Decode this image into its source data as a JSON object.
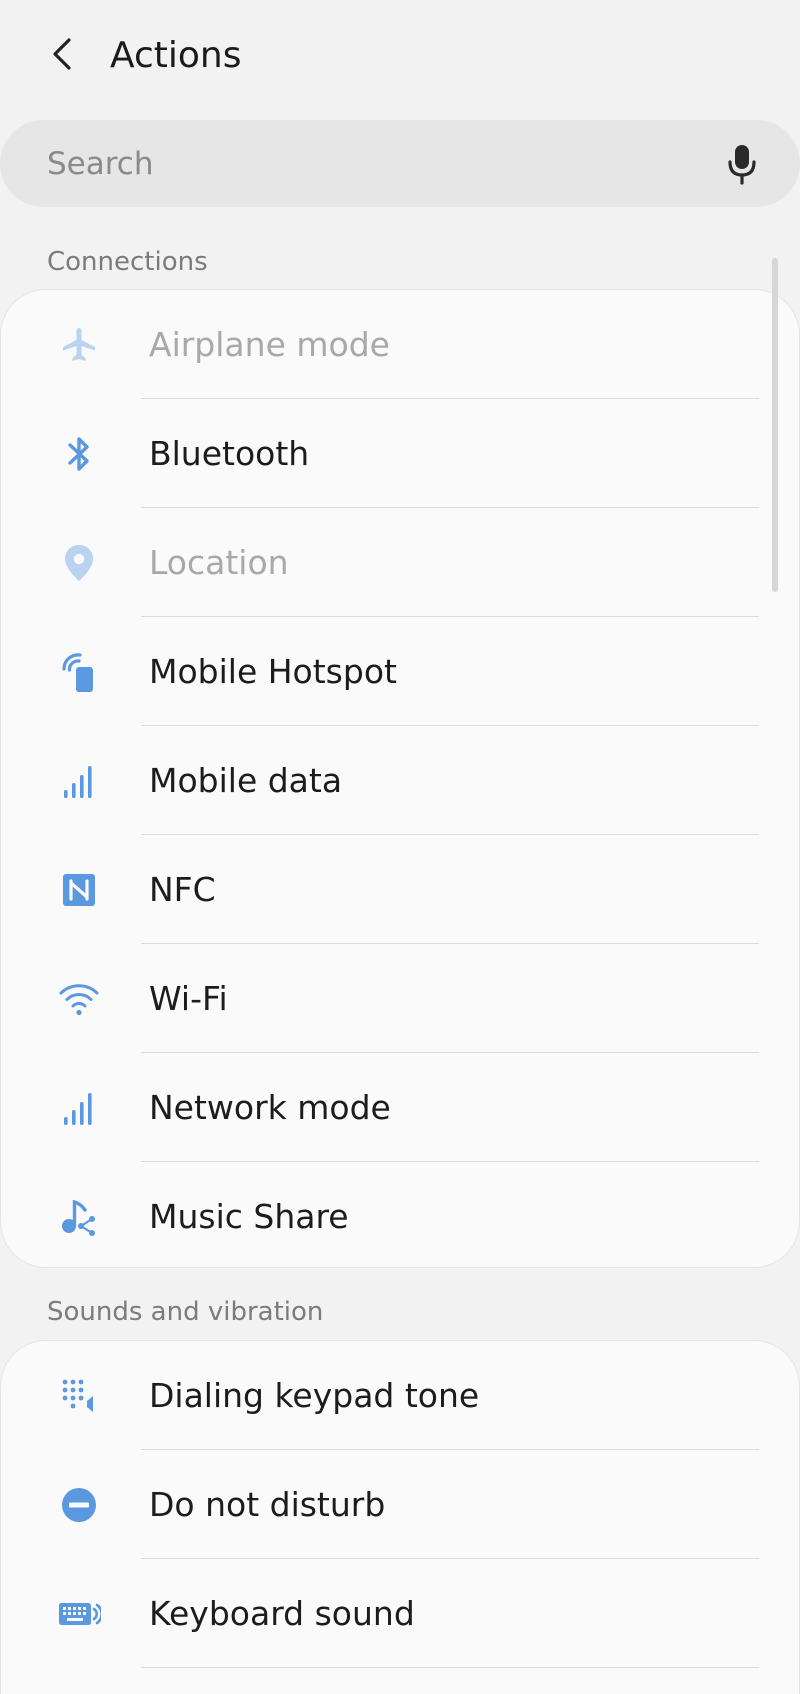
{
  "header": {
    "title": "Actions",
    "back_icon": "chevron-left-icon"
  },
  "search": {
    "placeholder": "Search",
    "value": "",
    "mic_icon": "microphone-icon"
  },
  "sections": [
    {
      "title": "Connections",
      "items": [
        {
          "label": "Airplane mode",
          "icon": "airplane-icon",
          "enabled": false
        },
        {
          "label": "Bluetooth",
          "icon": "bluetooth-icon",
          "enabled": true
        },
        {
          "label": "Location",
          "icon": "location-pin-icon",
          "enabled": false
        },
        {
          "label": "Mobile Hotspot",
          "icon": "hotspot-icon",
          "enabled": true
        },
        {
          "label": "Mobile data",
          "icon": "signal-bars-icon",
          "enabled": true
        },
        {
          "label": "NFC",
          "icon": "nfc-icon",
          "enabled": true
        },
        {
          "label": "Wi-Fi",
          "icon": "wifi-icon",
          "enabled": true
        },
        {
          "label": "Network mode",
          "icon": "signal-bars-icon",
          "enabled": true
        },
        {
          "label": "Music Share",
          "icon": "music-share-icon",
          "enabled": true
        }
      ]
    },
    {
      "title": "Sounds and vibration",
      "items": [
        {
          "label": "Dialing keypad tone",
          "icon": "keypad-tone-icon",
          "enabled": true
        },
        {
          "label": "Do not disturb",
          "icon": "do-not-disturb-icon",
          "enabled": true
        },
        {
          "label": "Keyboard sound",
          "icon": "keyboard-sound-icon",
          "enabled": true
        }
      ]
    }
  ],
  "colors": {
    "accent": "#5a98e0",
    "accent_disabled": "#b9d3f0",
    "background": "#f2f2f2",
    "card": "#fafafa",
    "text_primary": "#1c1c1c",
    "text_disabled": "#a8a8a8",
    "section_header": "#7b7b7b"
  }
}
